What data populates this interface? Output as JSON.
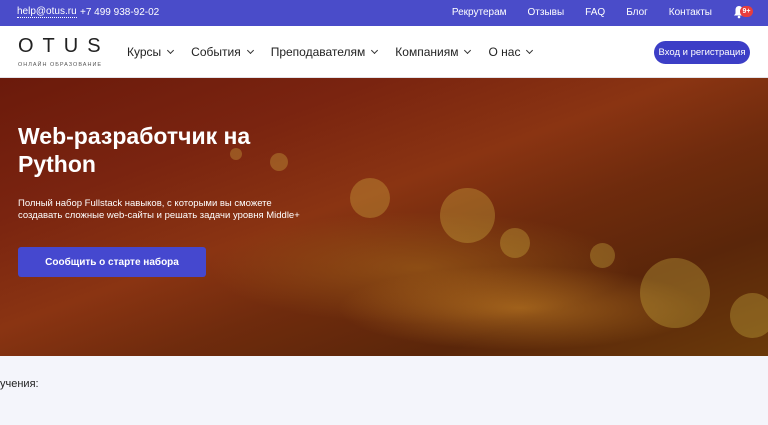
{
  "topbar": {
    "email": "help@otus.ru",
    "phone": "+7 499 938-92-02",
    "links": [
      "Рекрутерам",
      "Отзывы",
      "FAQ",
      "Блог",
      "Контакты"
    ],
    "notifications_badge": "9+"
  },
  "nav": {
    "logo_word": "OTUS",
    "logo_tagline": "ОНЛАЙН ОБРАЗОВАНИЕ",
    "menu": [
      "Курсы",
      "События",
      "Преподавателям",
      "Компаниям",
      "О нас"
    ],
    "login_label": "Вход и регистрация"
  },
  "hero": {
    "title": "Web-разработчик на Python",
    "description": "Полный набор Fullstack навыков, с которыми вы сможете создавать сложные web-сайты и решать задачи уровня Middle+",
    "cta_label": "Сообщить о старте набора"
  },
  "section": {
    "partial_text": "учения:"
  },
  "colors": {
    "topbar_bg": "#4a4cc9",
    "accent": "#3c3ec6",
    "badge": "#e73d3d"
  }
}
